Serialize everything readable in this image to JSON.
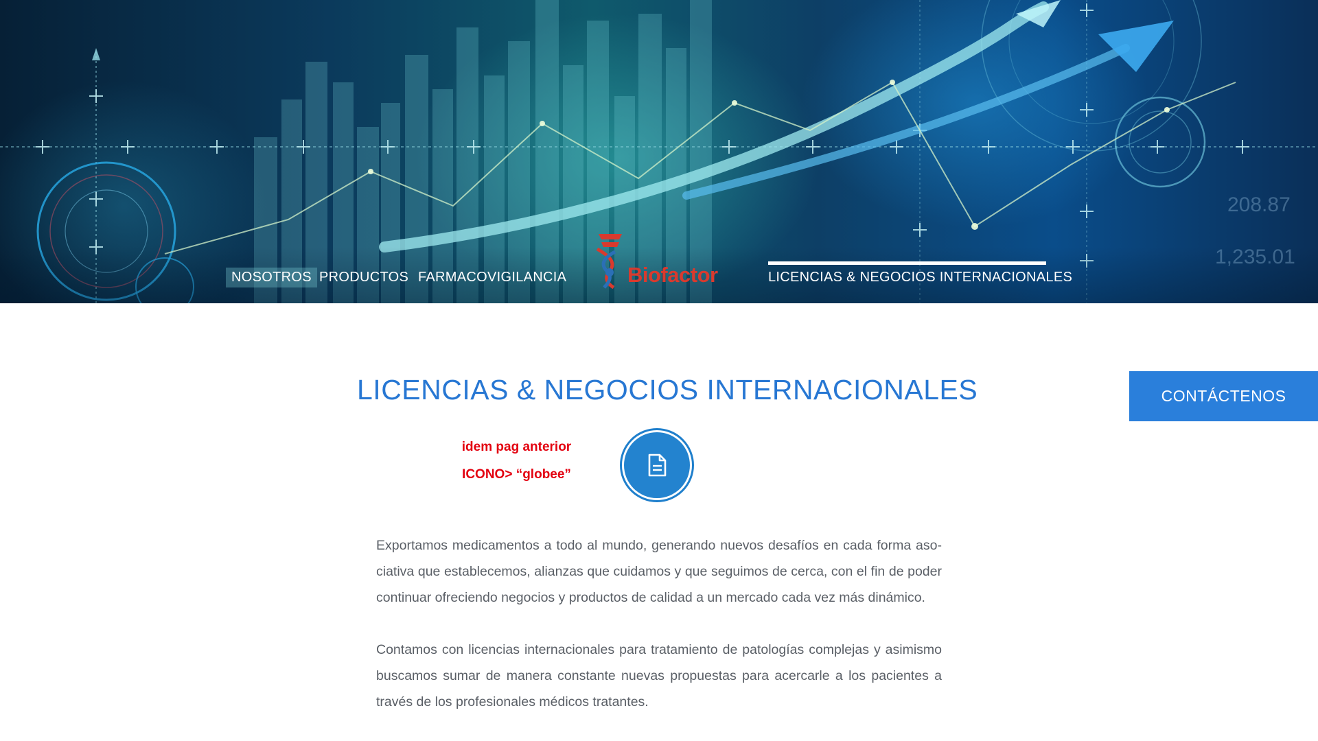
{
  "nav": {
    "items": [
      {
        "label": "NOSOTROS"
      },
      {
        "label": "PRODUCTOS"
      },
      {
        "label": "FARMACOVIGILANCIA"
      },
      {
        "label": "LICENCIAS & NEGOCIOS INTERNACIONALES",
        "active": true
      }
    ]
  },
  "logo": {
    "text": "Biofactor",
    "icon": "dna-helix-icon",
    "color": "#d93a2e"
  },
  "hero": {
    "ghost_numbers": [
      "208.87",
      "1,235.01"
    ]
  },
  "main": {
    "title": "LICENCIAS & NEGOCIOS INTERNACIONALES",
    "notes": [
      "idem pag anterior",
      "ICONO> “globee”"
    ],
    "feature_icon": "document-icon",
    "paragraphs": [
      "Exportamos medicamentos a todo al mundo, generando nuevos desafíos en cada forma aso-ciativa que establecemos, alianzas que cuidamos y que seguimos de cerca, con el fin de poder continuar ofreciendo negocios y productos de calidad a un mercado cada vez más dinámico.",
      "Contamos con licencias internacionales para tratamiento de patologías complejas y asimismo buscamos sumar de manera constante nuevas propuestas para acercarle a los pacientes a través de los profesionales médicos tratantes."
    ]
  },
  "contact_button": {
    "label": "CONTÁCTENOS"
  },
  "colors": {
    "accent": "#2a7fdb",
    "title": "#2777d3",
    "note": "#e3000f",
    "body_text": "#5a5f66"
  }
}
